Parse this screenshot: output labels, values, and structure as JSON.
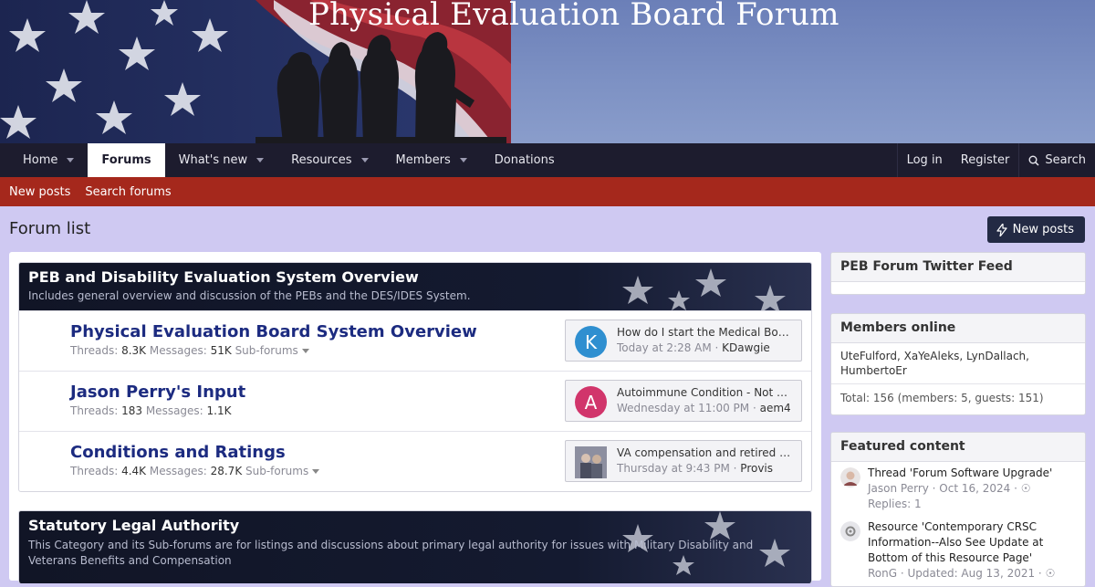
{
  "banner": {
    "title": "Physical Evaluation Board Forum"
  },
  "nav": {
    "items": [
      {
        "label": "Home",
        "dropdown": true
      },
      {
        "label": "Forums",
        "dropdown": false,
        "active": true
      },
      {
        "label": "What's new",
        "dropdown": true
      },
      {
        "label": "Resources",
        "dropdown": true
      },
      {
        "label": "Members",
        "dropdown": true
      },
      {
        "label": "Donations",
        "dropdown": false
      }
    ],
    "login": "Log in",
    "register": "Register",
    "search": "Search"
  },
  "subnav": {
    "new_posts": "New posts",
    "search_forums": "Search forums"
  },
  "page": {
    "title": "Forum list",
    "new_posts_button": "New posts"
  },
  "categories": [
    {
      "title": "PEB and Disability Evaluation System Overview",
      "description": "Includes general overview and discussion of the PEBs and the DES/IDES System.",
      "nodes": [
        {
          "title": "Physical Evaluation Board System Overview",
          "threads_label": "Threads:",
          "threads": "8.3K",
          "messages_label": "Messages:",
          "messages": "51K",
          "subforums": "Sub-forums",
          "last_post": {
            "title": "How do I start the Medical Board Process",
            "time": "Today at 2:28 AM",
            "user": "KDawgie",
            "avatar_letter": "K",
            "avatar_color": "#2f8fd0"
          }
        },
        {
          "title": "Jason Perry's Input",
          "threads_label": "Threads:",
          "threads": "183",
          "messages_label": "Messages:",
          "messages": "1.1K",
          "subforums": "",
          "last_post": {
            "title": "Autoimmune Condition - Not Service Connected",
            "time": "Wednesday at 11:00 PM",
            "user": "aem4",
            "avatar_letter": "A",
            "avatar_color": "#d1356b"
          }
        },
        {
          "title": "Conditions and Ratings",
          "threads_label": "Threads:",
          "threads": "4.4K",
          "messages_label": "Messages:",
          "messages": "28.7K",
          "subforums": "Sub-forums",
          "last_post": {
            "title": "VA compensation and retired pay",
            "time": "Thursday at 9:43 PM",
            "user": "Provis",
            "avatar_letter": "",
            "avatar_color": "#7a7f8c"
          }
        }
      ]
    },
    {
      "title": "Statutory Legal Authority",
      "description_line1": "This Category and its Sub-forums are for listings and discussions about primary legal authority for issues with Military Disability and",
      "description_line2": "Veterans Benefits and Compensation"
    }
  ],
  "sidebar": {
    "twitter": {
      "title": "PEB Forum Twitter Feed"
    },
    "members_online": {
      "title": "Members online",
      "names": "UteFulford, XaYeAleks, LynDallach, HumbertoEr",
      "total": "Total: 156 (members: 5, guests: 151)"
    },
    "featured": {
      "title": "Featured content",
      "items": [
        {
          "title": "Thread 'Forum Software Upgrade'",
          "meta": "Jason Perry · Oct 16, 2024 ·",
          "replies": "Replies: 1"
        },
        {
          "title": "Resource 'Contemporary CRSC Information--Also See Update at Bottom of this Resource Page'",
          "meta": "RonG · Updated: Aug 13, 2021 ·"
        }
      ]
    }
  },
  "colors": {
    "nav_bg": "#1d1c2e",
    "subnav_bg": "#a5281c",
    "page_bg": "#cfc9f2",
    "link": "#1c2b80"
  }
}
